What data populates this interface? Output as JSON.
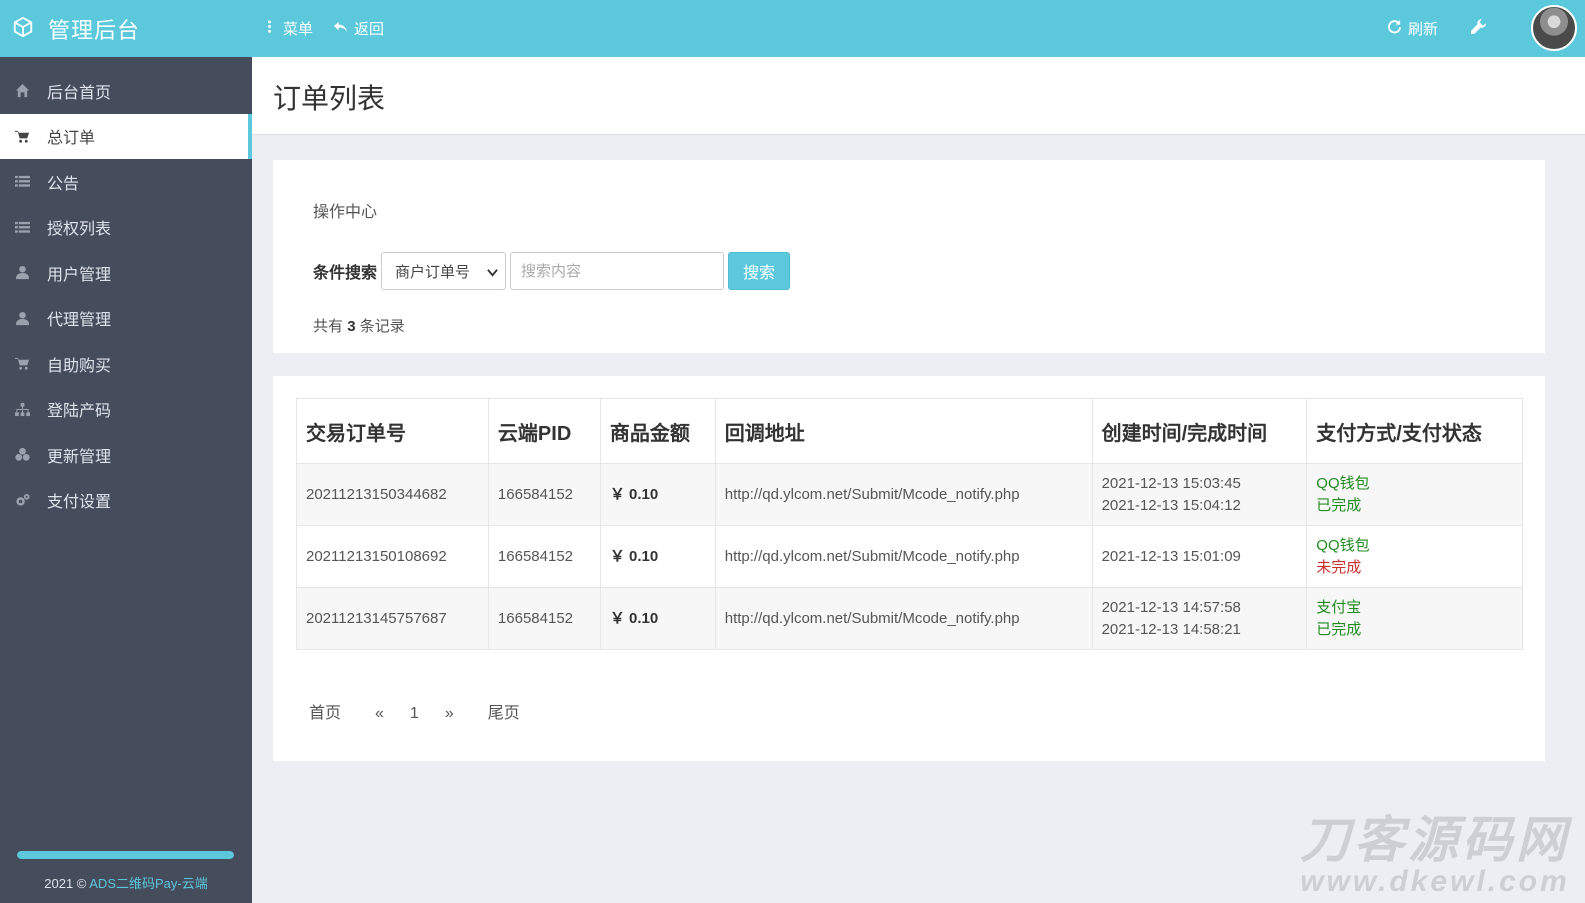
{
  "header": {
    "brand_title": "管理后台",
    "menu_label": "菜单",
    "back_label": "返回",
    "refresh_label": "刷新"
  },
  "sidebar": {
    "items": [
      {
        "label": "后台首页",
        "icon": "home-icon"
      },
      {
        "label": "总订单",
        "icon": "cart-icon",
        "active": true
      },
      {
        "label": "公告",
        "icon": "list-icon"
      },
      {
        "label": "授权列表",
        "icon": "list-icon"
      },
      {
        "label": "用户管理",
        "icon": "user-icon"
      },
      {
        "label": "代理管理",
        "icon": "user-icon"
      },
      {
        "label": "自助购买",
        "icon": "cart-icon"
      },
      {
        "label": "登陆产码",
        "icon": "sitemap-icon"
      },
      {
        "label": "更新管理",
        "icon": "cubes-icon"
      },
      {
        "label": "支付设置",
        "icon": "gears-icon"
      }
    ],
    "progress_fraction": 1.0,
    "footer_prefix": "2021 © ",
    "footer_brand": "ADS二维码Pay-云端"
  },
  "page": {
    "title": "订单列表"
  },
  "ops": {
    "title": "操作中心",
    "search_label": "条件搜索",
    "select_value": "商户订单号",
    "search_placeholder": "搜索内容",
    "search_button": "搜索",
    "count_prefix": "共有",
    "count_value": "3",
    "count_suffix": "条记录"
  },
  "table": {
    "headers": [
      "交易订单号",
      "云端PID",
      "商品金额",
      "回调地址",
      "创建时间/完成时间",
      "支付方式/支付状态"
    ],
    "rows": [
      {
        "order_no": "20211213150344682",
        "pid": "166584152",
        "amount": "￥ 0.10",
        "callback": "http://qd.ylcom.net/Submit/Mcode_notify.php",
        "created": "2021-12-13 15:03:45",
        "finished": "2021-12-13 15:04:12",
        "pay_method": "QQ钱包",
        "pay_status": "已完成",
        "status_color": "#228b22"
      },
      {
        "order_no": "20211213150108692",
        "pid": "166584152",
        "amount": "￥ 0.10",
        "callback": "http://qd.ylcom.net/Submit/Mcode_notify.php",
        "created": "2021-12-13 15:01:09",
        "finished": "",
        "pay_method": "QQ钱包",
        "pay_status": "未完成",
        "status_color": "#c9302c"
      },
      {
        "order_no": "20211213145757687",
        "pid": "166584152",
        "amount": "￥ 0.10",
        "callback": "http://qd.ylcom.net/Submit/Mcode_notify.php",
        "created": "2021-12-13 14:57:58",
        "finished": "2021-12-13 14:58:21",
        "pay_method": "支付宝",
        "pay_status": "已完成",
        "status_color": "#228b22"
      }
    ]
  },
  "pager": {
    "first": "首页",
    "prev": "«",
    "current": "1",
    "next": "»",
    "last": "尾页"
  },
  "watermark": {
    "big": "刀客源码网",
    "small": "www.dkewl.com"
  },
  "colors": {
    "accent": "#5bc8dc",
    "sidebar_bg": "#454c5c",
    "status_done": "#228b22",
    "status_pending": "#c9302c"
  }
}
